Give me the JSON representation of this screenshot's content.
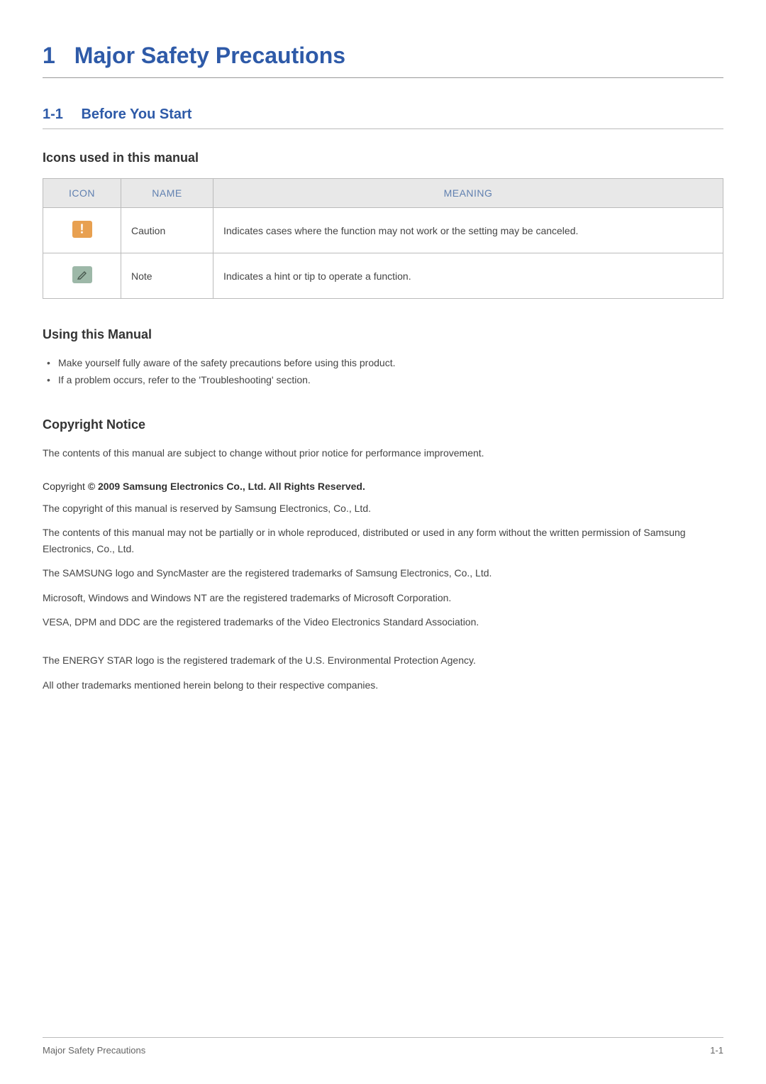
{
  "chapter": {
    "number": "1",
    "title": "Major Safety Precautions"
  },
  "section": {
    "number": "1-1",
    "title": "Before You Start"
  },
  "iconsBlock": {
    "heading": "Icons used in this manual",
    "headers": {
      "icon": "ICON",
      "name": "NAME",
      "meaning": "MEANING"
    },
    "rows": [
      {
        "iconName": "caution-icon",
        "name": "Caution",
        "meaning": "Indicates cases where the function may not work or the setting may be canceled."
      },
      {
        "iconName": "note-icon",
        "name": "Note",
        "meaning": "Indicates a hint or tip to operate a function."
      }
    ]
  },
  "usingManual": {
    "heading": "Using this Manual",
    "items": [
      "Make yourself fully aware of the safety precautions before using this product.",
      "If a problem occurs, refer to the 'Troubleshooting' section."
    ]
  },
  "copyrightNotice": {
    "heading": "Copyright Notice",
    "intro": "The contents of this manual are subject to change without prior notice for performance improvement.",
    "linePrefix": "Copyright ",
    "lineBold": "© 2009 Samsung Electronics Co., Ltd. All Rights Reserved.",
    "paragraphs": [
      "The copyright of this manual is reserved by Samsung Electronics, Co., Ltd.",
      "The contents of this manual may not be partially or in whole reproduced, distributed or used in any form without the written permission of Samsung Electronics, Co., Ltd.",
      "The SAMSUNG logo and SyncMaster are the registered trademarks of Samsung Electronics, Co., Ltd.",
      "Microsoft, Windows and Windows NT are the registered trademarks of Microsoft Corporation.",
      "VESA, DPM and DDC are the registered trademarks of the Video Electronics Standard Association."
    ],
    "tail": [
      "The ENERGY STAR logo is the registered trademark of the U.S. Environmental Protection Agency.",
      "All other trademarks mentioned herein belong to their respective companies."
    ]
  },
  "footer": {
    "left": "Major Safety Precautions",
    "right": "1-1"
  }
}
